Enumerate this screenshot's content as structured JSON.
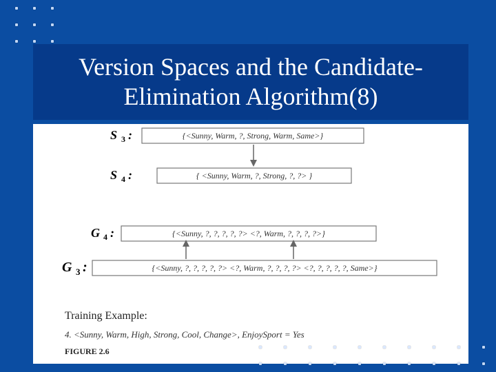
{
  "title": "Version Spaces and the Candidate-Elimination Algorithm(8)",
  "s3": {
    "label_main": "S",
    "label_sub": "3",
    "label_colon": ":",
    "content": "{<Sunny, Warm, ?, Strong, Warm, Same>}"
  },
  "s4": {
    "label_main": "S",
    "label_sub": "4",
    "label_colon": ":",
    "content": "{ <Sunny, Warm, ?, Strong, ?, ?> }"
  },
  "g4": {
    "label_main": "G",
    "label_sub": "4",
    "label_colon": ":",
    "content": "{<Sunny, ?, ?, ?, ?, ?>    <?, Warm, ?, ?, ?, ?>}"
  },
  "g3": {
    "label_main": "G",
    "label_sub": "3",
    "label_colon": ":",
    "content": "{<Sunny, ?, ?, ?, ?, ?>   <?, Warm, ?, ?, ?, ?>   <?, ?, ?, ?, ?, Same>}"
  },
  "training": {
    "heading": "Training Example:",
    "example_num": "4.",
    "example_text": "<Sunny, Warm, High, Strong, Cool, Change>,  EnjoySport = Yes"
  },
  "figure_label": "FIGURE 2.6"
}
